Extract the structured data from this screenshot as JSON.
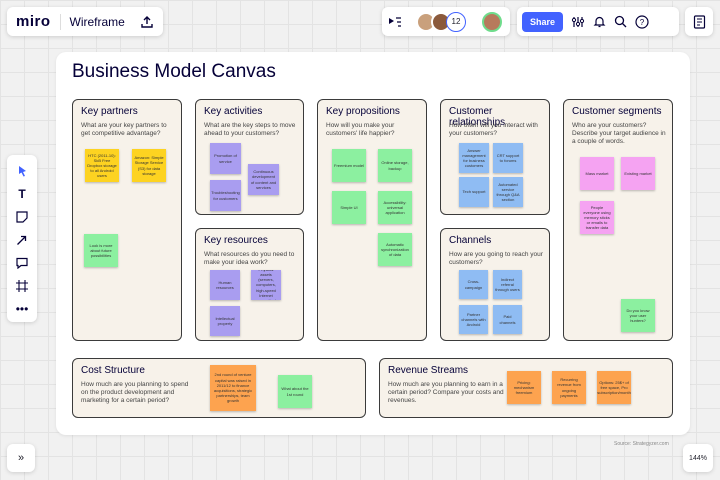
{
  "app": {
    "logo": "miro",
    "board_name": "Wireframe",
    "collaborator_count": "12",
    "share_label": "Share",
    "zoom": "144%"
  },
  "icons": {
    "export": "export-icon",
    "cursor": "cursor-icon",
    "text": "text-icon",
    "sticky": "sticky-note-icon",
    "arrow": "arrow-icon",
    "comment": "comment-icon",
    "frame": "frame-icon",
    "more": "more-icon",
    "settings": "settings-icon",
    "bell": "bell-icon",
    "search": "search-icon",
    "help": "help-icon",
    "notes": "notes-icon",
    "expand": "expand-icon"
  },
  "canvas": {
    "title": "Business Model Canvas",
    "source": "Source: Strategyzer.com"
  },
  "colors": {
    "accent": "#4262ff",
    "yellow": "#fdd321",
    "green": "#8cf0a0",
    "purple": "#a99df0",
    "blue": "#8fbcf3",
    "pink": "#f5a3f2",
    "orange": "#fda34f"
  },
  "sections": {
    "key_partners": {
      "title": "Key partners",
      "question": "What are your key partners to get competitive advantage?",
      "stickies": [
        "HTC (2011-10): SkB Free Dropbox storage to all Android users",
        "Amazon: Simple Storage Service (S3) for data storage",
        "Look is more about future possibilities"
      ]
    },
    "key_activities": {
      "title": "Key activities",
      "question": "What are the key steps to move ahead to your customers?",
      "stickies": [
        "Promotion of service",
        "Continuous development of content and services",
        "Troubleshooting for customers"
      ]
    },
    "key_resources": {
      "title": "Key resources",
      "question": "What resources do you need to make your idea work?",
      "stickies": [
        "Human resources",
        "Physical assets (servers, computers, high-speed Internet connection)",
        "Intellectual property"
      ]
    },
    "value_propositions": {
      "title": "Key propositions",
      "question": "How will you make your customers' life happier?",
      "stickies": [
        "Freemium model",
        "Online storage, backup",
        "Simple UI",
        "Accessibility: universal application",
        "Automatic synchronization of data"
      ]
    },
    "customer_relationships": {
      "title": "Customer relationships",
      "question": "How often will you interact with your customers?",
      "stickies": [
        "Answer management for business customers",
        "CRT support to forums",
        "Tech support",
        "Automated service through Q&A section"
      ]
    },
    "channels": {
      "title": "Channels",
      "question": "How are you going to reach your customers?",
      "stickies": [
        "Cross-campaign",
        "Indirect referral through users",
        "Partner channels with Android",
        "Paid channels"
      ]
    },
    "customer_segments": {
      "title": "Customer segments",
      "question": "Who are your customers? Describe your target audience in a couple of words.",
      "stickies": [
        "Mass market",
        "Existing market",
        "People everyone using memory sticks or emails to transfer data",
        "Do you know your user hunters?"
      ]
    },
    "cost_structure": {
      "title": "Cost Structure",
      "question": "How much are you planning to spend on the product development and marketing for a certain period?",
      "stickies": [
        "2nd round of venture capital was raised in 2011/12 to finance acquisitions, strategic partnerships, team growth",
        "What about the 1st round"
      ]
    },
    "revenue_streams": {
      "title": "Revenue Streams",
      "question": "How much are you planning to earn in a certain period? Compare your costs and revenues.",
      "stickies": [
        "Pricing: mechanism freemium",
        "Recurring revenue from ongoing payments",
        "Options: 25$+ of free space, Pro subscription/month"
      ]
    }
  }
}
